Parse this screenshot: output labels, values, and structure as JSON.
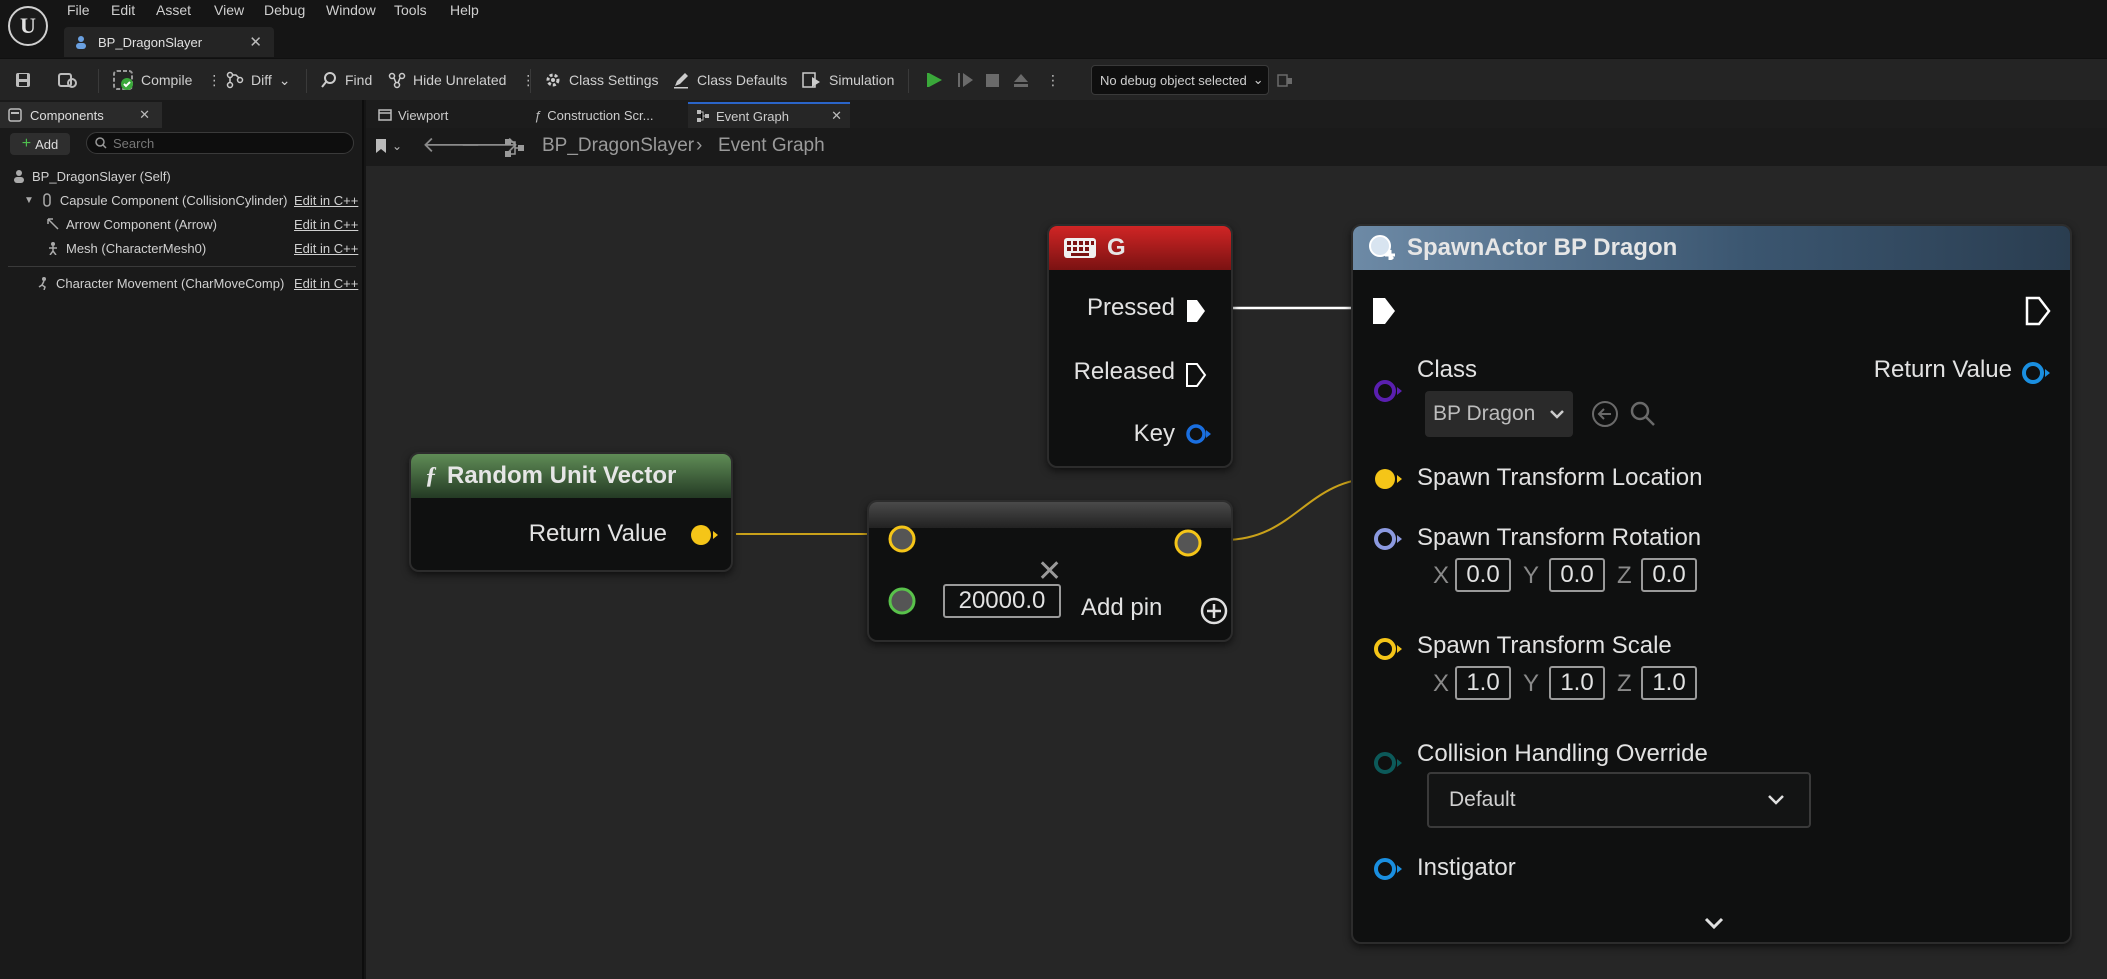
{
  "menu": [
    "File",
    "Edit",
    "Asset",
    "View",
    "Debug",
    "Window",
    "Tools",
    "Help"
  ],
  "document_tab": {
    "title": "BP_DragonSlayer"
  },
  "toolbar": {
    "compile": "Compile",
    "diff": "Diff",
    "find": "Find",
    "hide_unrelated": "Hide Unrelated",
    "class_settings": "Class Settings",
    "class_defaults": "Class Defaults",
    "simulation": "Simulation",
    "debug_object": "No debug object selected"
  },
  "components_panel": {
    "tab": "Components",
    "add": "Add",
    "search_placeholder": "Search",
    "root": "BP_DragonSlayer (Self)",
    "items": [
      {
        "label": "Capsule Component (CollisionCylinder)",
        "edit": "Edit in C++"
      },
      {
        "label": "Arrow Component (Arrow)",
        "edit": "Edit in C++"
      },
      {
        "label": "Mesh (CharacterMesh0)",
        "edit": "Edit in C++"
      },
      {
        "label": "Character Movement (CharMoveComp)",
        "edit": "Edit in C++"
      }
    ]
  },
  "graph_tabs": [
    "Viewport",
    "Construction Scr...",
    "Event Graph"
  ],
  "breadcrumb": {
    "blueprint": "BP_DragonSlayer",
    "graph": "Event Graph"
  },
  "nodes": {
    "key_event": {
      "title": "G",
      "pressed": "Pressed",
      "released": "Released",
      "key": "Key"
    },
    "random_unit_vector": {
      "title": "Random Unit Vector",
      "return_value": "Return Value"
    },
    "multiply": {
      "value": "20000.0",
      "add_pin": "Add pin"
    },
    "spawn_actor": {
      "title": "SpawnActor BP Dragon",
      "class_label": "Class",
      "class_value": "BP Dragon",
      "return_value": "Return Value",
      "location": "Spawn Transform Location",
      "rotation": "Spawn Transform Rotation",
      "rot_x": "0.0",
      "rot_y": "0.0",
      "rot_z": "0.0",
      "scale": "Spawn Transform Scale",
      "scale_x": "1.0",
      "scale_y": "1.0",
      "scale_z": "1.0",
      "collision": "Collision Handling Override",
      "collision_value": "Default",
      "instigator": "Instigator",
      "axis_x": "X",
      "axis_y": "Y",
      "axis_z": "Z"
    }
  },
  "colors": {
    "exec": "#ffffff",
    "vector": "#f5c518",
    "float": "#59c24b",
    "class": "#5a1fb0",
    "rotator": "#8c9ae0",
    "object": "#1a8fe0",
    "enum": "#0c5a5a",
    "key_header": "#b02020",
    "function_header": "#3f6a3f",
    "spawn_header": "#40607e"
  }
}
